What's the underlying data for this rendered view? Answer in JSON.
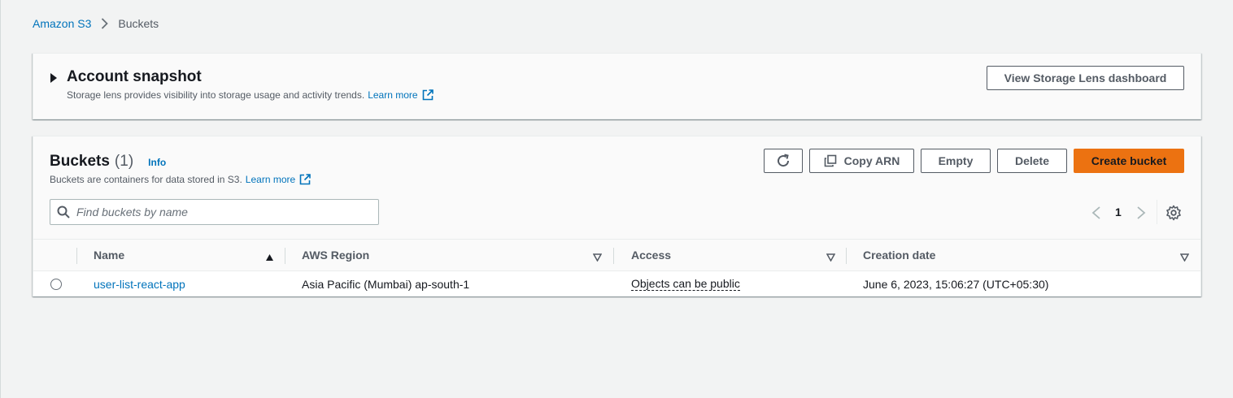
{
  "breadcrumb": {
    "root": "Amazon S3",
    "current": "Buckets"
  },
  "snapshot": {
    "title": "Account snapshot",
    "description": "Storage lens provides visibility into storage usage and activity trends.",
    "learn_more": "Learn more",
    "button_label": "View Storage Lens dashboard"
  },
  "buckets": {
    "title": "Buckets",
    "count": "(1)",
    "info": "Info",
    "description": "Buckets are containers for data stored in S3.",
    "learn_more": "Learn more",
    "actions": {
      "copy_arn": "Copy ARN",
      "empty": "Empty",
      "delete": "Delete",
      "create": "Create bucket"
    },
    "search_placeholder": "Find buckets by name",
    "pagination": {
      "current_page": "1"
    },
    "columns": [
      "Name",
      "AWS Region",
      "Access",
      "Creation date"
    ],
    "rows": [
      {
        "name": "user-list-react-app",
        "region": "Asia Pacific (Mumbai) ap-south-1",
        "access": "Objects can be public",
        "created": "June 6, 2023, 15:06:27 (UTC+05:30)"
      }
    ]
  },
  "colors": {
    "link": "#0073bb",
    "primary_button": "#ec7211",
    "background": "#f2f3f3"
  }
}
